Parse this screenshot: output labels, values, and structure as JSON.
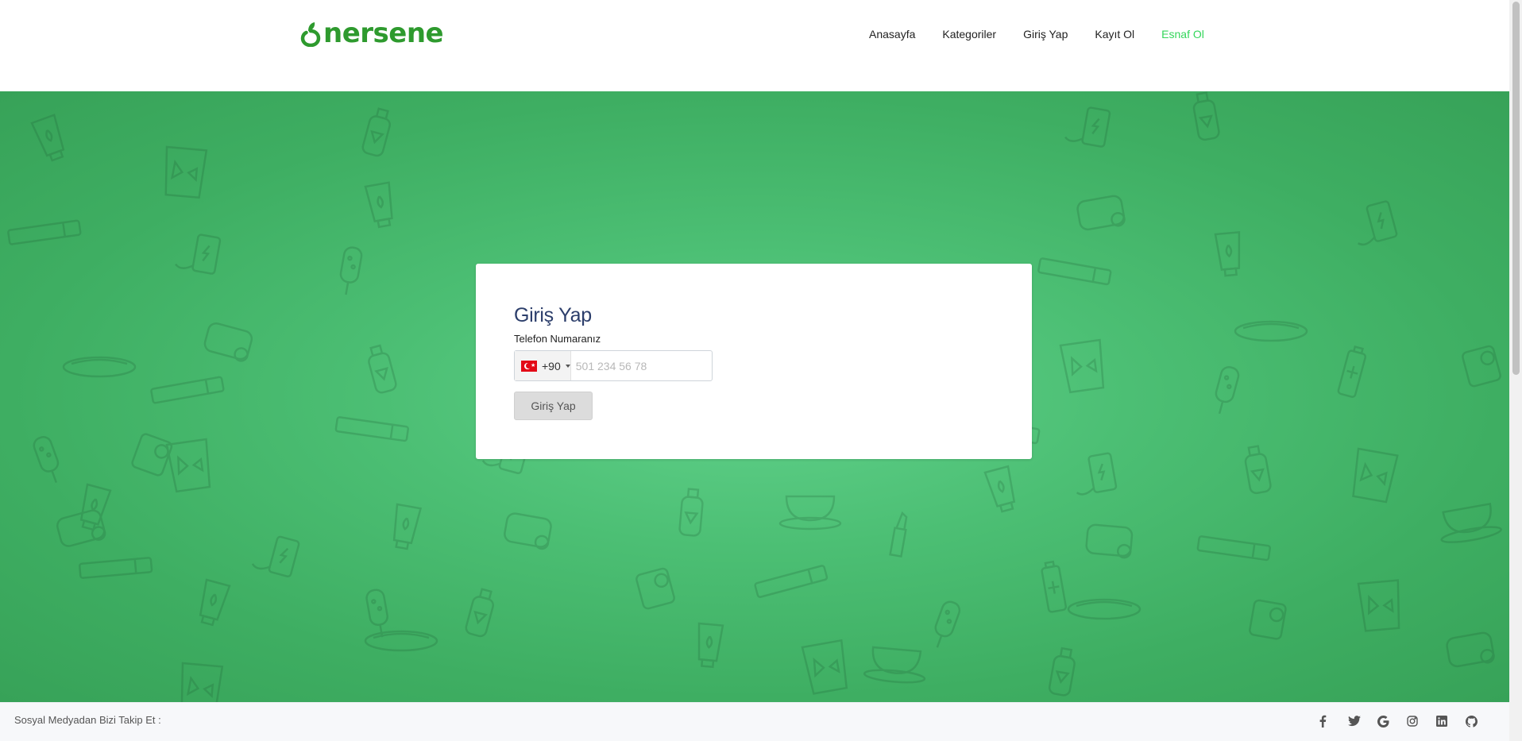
{
  "header": {
    "logo_text": "nersene",
    "brand_color": "#2e9a2e",
    "nav": [
      {
        "label": "Anasayfa",
        "active": false
      },
      {
        "label": "Kategoriler",
        "active": false
      },
      {
        "label": "Giriş Yap",
        "active": false
      },
      {
        "label": "Kayıt Ol",
        "active": false
      },
      {
        "label": "Esnaf Ol",
        "active": true
      }
    ],
    "active_color": "#33d65a"
  },
  "login": {
    "title": "Giriş Yap",
    "phone_label": "Telefon Numaranız",
    "country_flag": "turkey-flag",
    "dial_code": "+90",
    "phone_value": "",
    "phone_placeholder": "501 234 56 78",
    "submit_label": "Giriş Yap"
  },
  "hero": {
    "background_color": "#4cbf74"
  },
  "footer": {
    "follow_text": "Sosyal Medyadan Bizi Takip Et :",
    "social_icons": [
      "facebook-icon",
      "twitter-icon",
      "google-icon",
      "instagram-icon",
      "linkedin-icon",
      "github-icon"
    ]
  }
}
